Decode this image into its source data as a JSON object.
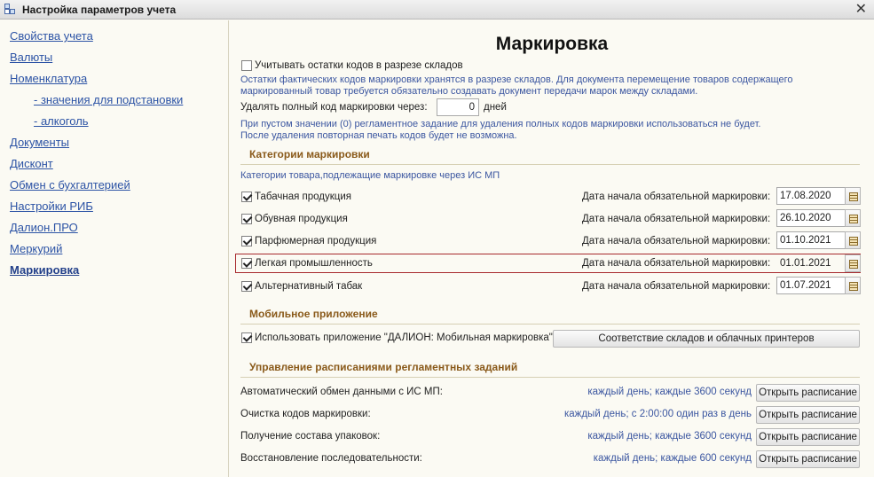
{
  "window": {
    "title": "Настройка параметров учета"
  },
  "sidebar": {
    "items": [
      {
        "label": "Свойства учета"
      },
      {
        "label": "Валюты"
      },
      {
        "label": "Номенклатура"
      },
      {
        "label": "- значения для подстановки"
      },
      {
        "label": "- алкоголь"
      },
      {
        "label": "Документы"
      },
      {
        "label": "Дисконт"
      },
      {
        "label": "Обмен с бухгалтерией"
      },
      {
        "label": "Настройки РИБ"
      },
      {
        "label": "Далион.ПРО"
      },
      {
        "label": "Меркурий"
      },
      {
        "label": "Маркировка"
      }
    ],
    "active": "Маркировка"
  },
  "main": {
    "title": "Маркировка",
    "warehouse_option": {
      "label": "Учитывать остатки кодов в разрезе складов",
      "checked": false,
      "note": "Остатки фактических кодов маркировки хранятся в разрезе складов. Для документа перемещение товаров содержащего маркированный товар требуется обязательно создавать документ передачи марок между складами.",
      "note_line1": "Остатки фактических кодов маркировки хранятся в разрезе складов. Для документа перемещение товаров содержащего",
      "note_line2": "маркированный товар требуется обязательно создавать документ передачи марок между складами."
    },
    "delete_codes": {
      "label": "Удалять полный код маркировки через:",
      "value": "0",
      "unit": "дней",
      "note_line1": "При пустом значении (0) регламентное задание для удаления полных кодов маркировки использоваться не будет.",
      "note_line2": "После удаления повторная печать кодов будет не возможна."
    },
    "categories": {
      "section_title": "Категории маркировки",
      "subtitle": "Категории товара,подлежащие маркировке через ИС МП",
      "date_label": "Дата начала обязательной маркировки:",
      "items": [
        {
          "label": "Табачная продукция",
          "checked": true,
          "date": "17.08.2020"
        },
        {
          "label": "Обувная продукция",
          "checked": true,
          "date": "26.10.2020"
        },
        {
          "label": "Парфюмерная продукция",
          "checked": true,
          "date": "01.10.2021"
        },
        {
          "label": "Легкая промышленность",
          "checked": true,
          "date": "01.01.2021",
          "highlighted": true
        },
        {
          "label": "Альтернативный табак",
          "checked": true,
          "date": "01.07.2021"
        }
      ]
    },
    "mobile": {
      "section_title": "Мобильное приложение",
      "use_app_label": "Использовать приложение \"ДАЛИОН: Мобильная маркировка\"",
      "checked": true,
      "mapping_button": "Соответствие складов и облачных принтеров"
    },
    "schedules": {
      "section_title": "Управление расписаниями регламентных заданий",
      "button_label": "Открыть расписание",
      "items": [
        {
          "label": "Автоматический обмен данными с ИС МП:",
          "schedule": "каждый день; каждые 3600 секунд"
        },
        {
          "label": "Очистка кодов маркировки:",
          "schedule": "каждый день; с 2:00:00 один раз в день"
        },
        {
          "label": "Получение состава упаковок:",
          "schedule": "каждый день; каждые 3600 секунд"
        },
        {
          "label": "Восстановление последовательности:",
          "schedule": "каждый день; каждые 600 секунд"
        }
      ]
    }
  },
  "colors": {
    "link": "#2c53a5",
    "section": "#8a5a1a",
    "note": "#3b56a0",
    "highlight_border": "#a7292d",
    "background": "#fbfaf3"
  }
}
